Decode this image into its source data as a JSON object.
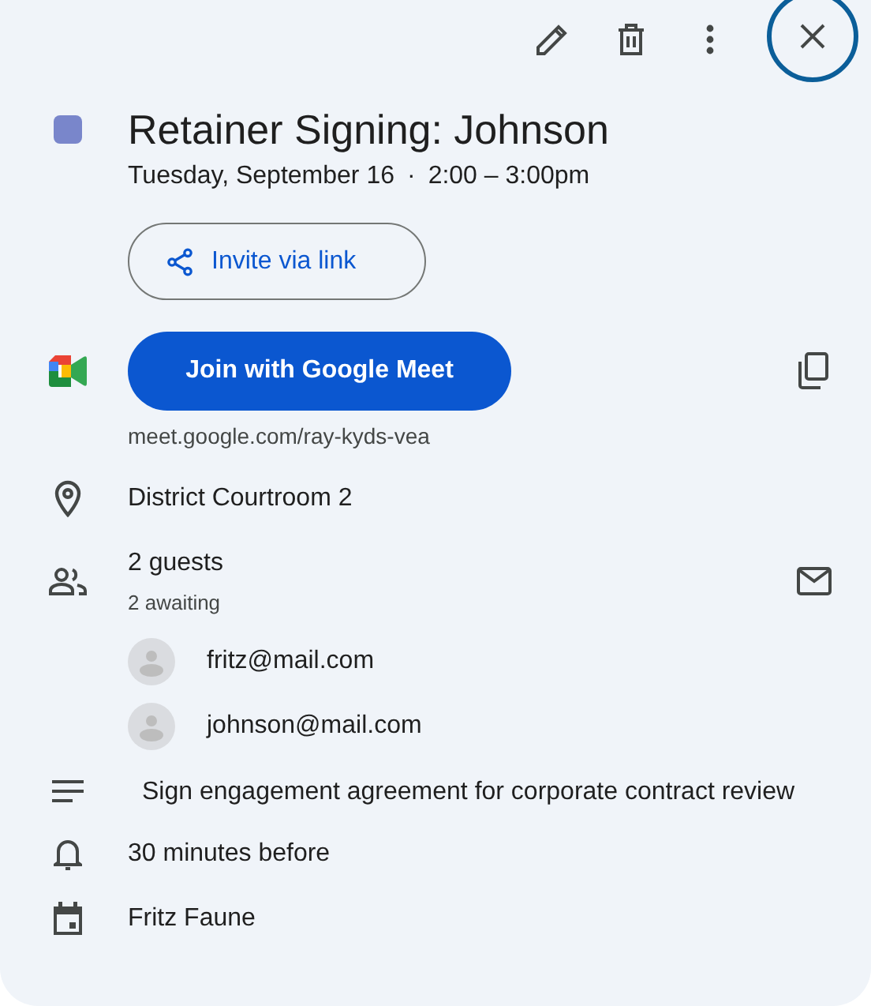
{
  "toolbar": {
    "buttons": [
      {
        "kind": "edit"
      },
      {
        "kind": "delete"
      },
      {
        "kind": "more"
      },
      {
        "kind": "close",
        "focused": true
      }
    ]
  },
  "event": {
    "color": "#7986cb",
    "title": "Retainer Signing: Johnson",
    "date": "Tuesday, September 16",
    "separator": "·",
    "time": "2:00 – 3:00pm"
  },
  "invite_button": "Invite via link",
  "meet": {
    "button": "Join with Google Meet",
    "url": "meet.google.com/ray-kyds-vea"
  },
  "location": "District Courtroom 2",
  "guests": {
    "count": "2 guests",
    "status": "2 awaiting",
    "list": [
      {
        "email": "fritz@mail.com"
      },
      {
        "email": "johnson@mail.com"
      }
    ]
  },
  "description": "Sign engagement agreement for corporate contract review",
  "reminder": "30 minutes before",
  "calendar": "Fritz Faune"
}
